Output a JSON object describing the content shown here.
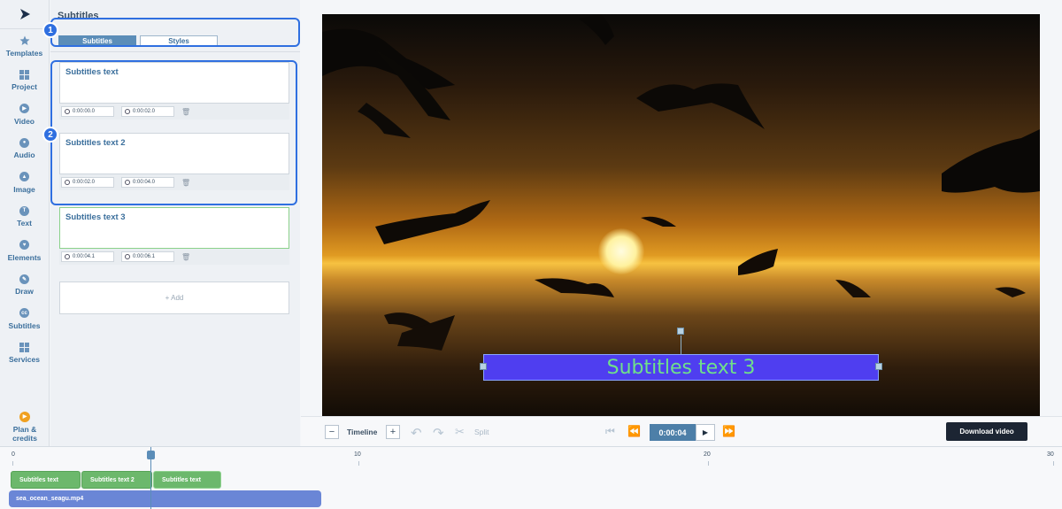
{
  "nav": {
    "items": [
      {
        "label": "Templates",
        "icon": "star-icon"
      },
      {
        "label": "Project",
        "icon": "grid-icon"
      },
      {
        "label": "Video",
        "icon": "play-circle-icon"
      },
      {
        "label": "Audio",
        "icon": "audio-icon"
      },
      {
        "label": "Image",
        "icon": "image-icon"
      },
      {
        "label": "Text",
        "icon": "text-icon"
      },
      {
        "label": "Elements",
        "icon": "heart-icon"
      },
      {
        "label": "Draw",
        "icon": "pencil-icon"
      },
      {
        "label": "Subtitles",
        "icon": "cc-icon"
      },
      {
        "label": "Services",
        "icon": "grid-icon"
      }
    ],
    "plan_label": "Plan &\ncredits"
  },
  "panel": {
    "title": "Subtitles",
    "tabs": [
      {
        "label": "Subtitles",
        "active": true
      },
      {
        "label": "Styles",
        "active": false
      }
    ],
    "subtitles": [
      {
        "text": "Subtitles text",
        "start": "0:00:00.0",
        "end": "0:00:02.0"
      },
      {
        "text": "Subtitles text 2",
        "start": "0:00:02.0",
        "end": "0:00:04.0"
      },
      {
        "text": "Subtitles text 3",
        "start": "0:00:04.1",
        "end": "0:00:06.1"
      }
    ],
    "add_label": "+ Add"
  },
  "annotations": {
    "badge1": "1",
    "badge2": "2"
  },
  "video": {
    "subtitle_overlay": "Subtitles text 3"
  },
  "controls": {
    "minus": "−",
    "timeline_label": "Timeline",
    "plus": "+",
    "split_label": "Split",
    "time": "0:00:04",
    "download_label": "Download video"
  },
  "timeline": {
    "ticks": [
      "0",
      "10",
      "20",
      "30"
    ],
    "subtitle_clips": [
      "Subtitles text",
      "Subtitles text 2",
      "Subtitles text"
    ],
    "video_clip": "sea_ocean_seagu.mp4"
  },
  "colors": {
    "accent": "#5b8db8",
    "highlight": "#2f6fe0",
    "subtitle_clip": "#6cb86c",
    "video_clip": "#6a86d6",
    "overlay_bg": "#4f3ef0",
    "overlay_text": "#6fe08a"
  }
}
